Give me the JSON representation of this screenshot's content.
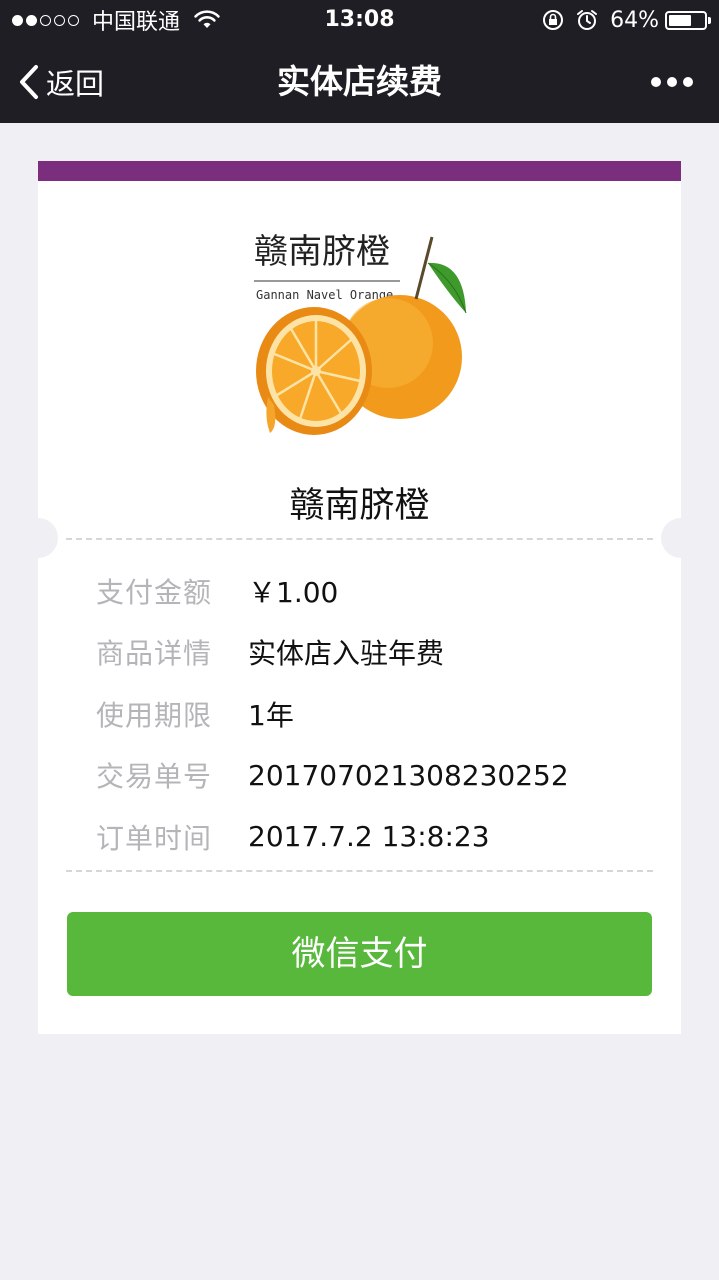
{
  "status_bar": {
    "carrier": "中国联通",
    "time": "13:08",
    "battery": "64%",
    "battery_level": 0.64,
    "signal_strength": 2,
    "signal_total": 5,
    "icons": [
      "wifi-icon",
      "orientation-lock-icon",
      "alarm-icon",
      "battery-icon"
    ]
  },
  "nav": {
    "back_label": "返回",
    "title": "实体店续费",
    "back_icon": "chevron-left-icon",
    "more_icon": "more-dots-icon"
  },
  "card": {
    "accent_color": "#7b2e7d",
    "product_logo": {
      "text_cn": "赣南脐橙",
      "text_en": "Gannan Navel Orange"
    },
    "product_name": "赣南脐橙",
    "details": [
      {
        "label": "支付金额",
        "value": "￥1.00"
      },
      {
        "label": "商品详情",
        "value": "实体店入驻年费"
      },
      {
        "label": "使用期限",
        "value": "1年"
      },
      {
        "label": "交易单号",
        "value": "201707021308230252"
      },
      {
        "label": "订单时间",
        "value": "2017.7.2 13:8:23"
      }
    ],
    "pay_button_label": "微信支付",
    "pay_button_color": "#57b83b"
  }
}
